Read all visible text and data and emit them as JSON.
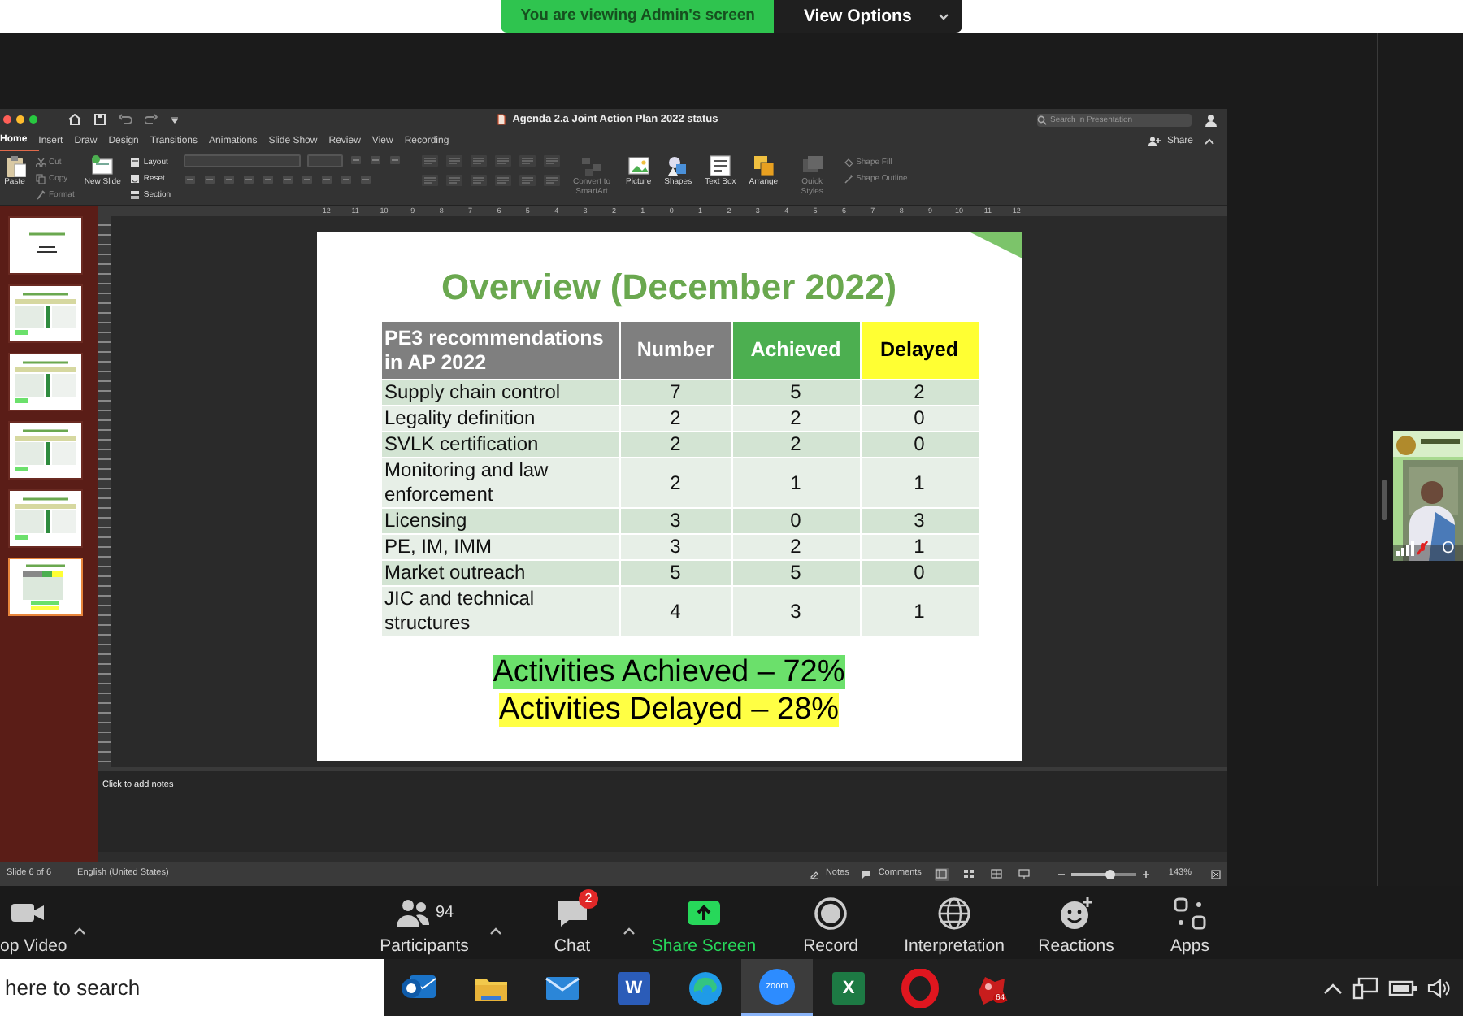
{
  "share_banner": {
    "message": "You are viewing Admin's screen",
    "button": "View Options"
  },
  "powerpoint": {
    "title": "Agenda 2.a Joint Action Plan 2022 status",
    "search": {
      "placeholder": "Search in Presentation"
    },
    "tabs": [
      {
        "label": "Home",
        "selected": true
      },
      {
        "label": "Insert",
        "selected": false
      },
      {
        "label": "Draw",
        "selected": false
      },
      {
        "label": "Design",
        "selected": false
      },
      {
        "label": "Transitions",
        "selected": false
      },
      {
        "label": "Animations",
        "selected": false
      },
      {
        "label": "Slide Show",
        "selected": false
      },
      {
        "label": "Review",
        "selected": false
      },
      {
        "label": "View",
        "selected": false
      },
      {
        "label": "Recording",
        "selected": false
      }
    ],
    "share_button": "Share",
    "ribbon": [
      {
        "kind": "large",
        "label": "Paste",
        "disabled": false
      },
      {
        "kind": "stack",
        "items": [
          {
            "label": "Cut",
            "disabled": true
          },
          {
            "label": "Copy",
            "disabled": true
          },
          {
            "label": "Format",
            "disabled": true
          }
        ]
      },
      {
        "kind": "large",
        "label": "New Slide",
        "disabled": false
      },
      {
        "kind": "stack",
        "items": [
          {
            "label": "Layout",
            "disabled": false
          },
          {
            "label": "Reset",
            "disabled": false
          },
          {
            "label": "Section",
            "disabled": false
          }
        ]
      },
      {
        "kind": "font"
      },
      {
        "kind": "paragraph"
      },
      {
        "kind": "large",
        "label": "Convert to SmartArt",
        "disabled": true
      },
      {
        "kind": "large",
        "label": "Picture",
        "disabled": false
      },
      {
        "kind": "large",
        "label": "Shapes",
        "disabled": false
      },
      {
        "kind": "large",
        "label": "Text Box",
        "disabled": false
      },
      {
        "kind": "large",
        "label": "Arrange",
        "disabled": false
      },
      {
        "kind": "large",
        "label": "Quick Styles",
        "disabled": true
      },
      {
        "kind": "stack",
        "items": [
          {
            "label": "Shape Fill",
            "disabled": true
          },
          {
            "label": "Shape Outline",
            "disabled": true
          }
        ]
      }
    ],
    "ruler_labels": [
      "12",
      "11",
      "10",
      "9",
      "8",
      "7",
      "6",
      "5",
      "4",
      "3",
      "2",
      "1",
      "0",
      "1",
      "2",
      "3",
      "4",
      "5",
      "6",
      "7",
      "8",
      "9",
      "10",
      "11",
      "12"
    ],
    "thumbnails": [
      {
        "kind": "title",
        "selected": false
      },
      {
        "kind": "table",
        "selected": false
      },
      {
        "kind": "table",
        "selected": false
      },
      {
        "kind": "table",
        "selected": false
      },
      {
        "kind": "table",
        "selected": false
      },
      {
        "kind": "overview",
        "selected": true
      }
    ],
    "slide": {
      "title": "Overview (December 2022)",
      "columns": [
        {
          "label": "PE3 recommendations in AP 2022",
          "kind": "topic"
        },
        {
          "label": "Number",
          "kind": "number"
        },
        {
          "label": "Achieved",
          "kind": "achieved"
        },
        {
          "label": "Delayed",
          "kind": "delayed"
        }
      ],
      "rows": [
        [
          "Supply chain control",
          "7",
          "5",
          "2"
        ],
        [
          "Legality definition",
          "2",
          "2",
          "0"
        ],
        [
          "SVLK certification",
          "2",
          "2",
          "0"
        ],
        [
          "Monitoring and law enforcement",
          "2",
          "1",
          "1"
        ],
        [
          "Licensing",
          "3",
          "0",
          "3"
        ],
        [
          "PE, IM, IMM",
          "3",
          "2",
          "1"
        ],
        [
          "Market outreach",
          "5",
          "5",
          "0"
        ],
        [
          "JIC and technical structures",
          "4",
          "3",
          "1"
        ]
      ],
      "summary": [
        {
          "text": "Activities Achieved – 72%",
          "kind": "achieved"
        },
        {
          "text": "Activities Delayed – 28%",
          "kind": "delayed"
        }
      ]
    },
    "notes_placeholder": "Click to add notes",
    "status_bar": {
      "slide": "Slide 6 of 6",
      "language": "English (United States)",
      "notes": "Notes",
      "comments": "Comments",
      "views": [
        {
          "selected": true
        },
        {
          "selected": false
        },
        {
          "selected": false
        },
        {
          "selected": false
        }
      ],
      "zoom": {
        "level": 0.6,
        "reading": "143%"
      }
    }
  },
  "zoom_toolbar": [
    {
      "kind": "video",
      "label": "op Video",
      "caret": true
    },
    {
      "kind": "participants",
      "label": "Participants",
      "count": "94",
      "caret": true
    },
    {
      "kind": "chat",
      "label": "Chat",
      "badge": "2",
      "caret": true
    },
    {
      "kind": "share",
      "label": "Share Screen",
      "caret": false
    },
    {
      "kind": "record",
      "label": "Record",
      "caret": false
    },
    {
      "kind": "interpretation",
      "label": "Interpretation",
      "caret": false
    },
    {
      "kind": "reactions",
      "label": "Reactions",
      "caret": false
    },
    {
      "kind": "apps",
      "label": "Apps",
      "caret": false
    }
  ],
  "participant_tile": {
    "name": "O",
    "muted": true
  },
  "taskbar": {
    "search": {
      "placeholder": "here to search"
    },
    "apps": [
      {
        "kind": "outlook",
        "selected": false
      },
      {
        "kind": "explorer",
        "selected": false
      },
      {
        "kind": "mail",
        "selected": false
      },
      {
        "kind": "word",
        "logo_text": "W",
        "selected": false
      },
      {
        "kind": "edge",
        "selected": false
      },
      {
        "kind": "zoom",
        "logo_text": "zoom",
        "selected": true
      },
      {
        "kind": "excel",
        "logo_text": "X",
        "selected": false
      },
      {
        "kind": "opera",
        "selected": false
      },
      {
        "kind": "game",
        "badge": "64",
        "selected": false
      }
    ]
  }
}
